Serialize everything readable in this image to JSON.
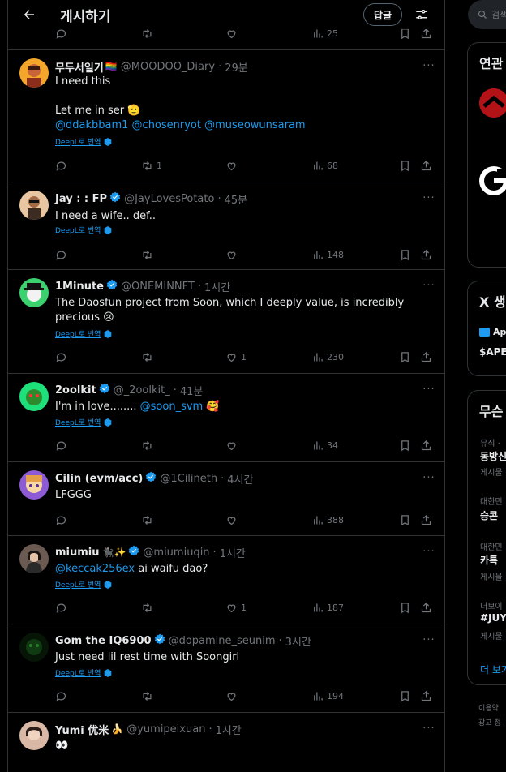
{
  "header": {
    "title": "게시하기",
    "reply_filter_label": "답글"
  },
  "previous_tweet": {
    "views": "25"
  },
  "tweets": [
    {
      "name": "무두서일기",
      "name_badge": "🏳️‍🌈",
      "handle": "@MOODOO_Diary",
      "time": "29분",
      "verified": false,
      "lines": [
        "I need this",
        "",
        "Let me in ser 🫡"
      ],
      "mentions": [
        "@ddakbbam1",
        "@chosenryot",
        "@museowunsaram"
      ],
      "translate": "DeepL로 번역",
      "reposts": "1",
      "likes": "",
      "views": "68",
      "avatar_color": "#f4a62a"
    },
    {
      "name": "Jay : : FP",
      "handle": "@JayLovesPotato",
      "time": "45분",
      "verified": true,
      "text": "I need a wife.. def..",
      "translate": "DeepL로 번역",
      "reposts": "",
      "likes": "",
      "views": "148",
      "avatar_color": "#e9c6a2"
    },
    {
      "name": "1Minute",
      "handle": "@ONEMINNFT",
      "time": "1시간",
      "verified": true,
      "text": "The Daosfun project from Soon, which I deeply value, is incredibly precious 😢",
      "translate": "DeepL로 번역",
      "reposts": "",
      "likes": "1",
      "views": "230",
      "avatar_color": "#3bd16f"
    },
    {
      "name": "2oolkit",
      "handle": "@_2oolkit_",
      "time": "41분",
      "verified": true,
      "text_before": "I'm in love........",
      "mention": "@soon_svm",
      "text_after": "🥰",
      "translate": "DeepL로 번역",
      "reposts": "",
      "likes": "",
      "views": "34",
      "avatar_color": "#1ee07a"
    },
    {
      "name": "Cilin (evm/acc)",
      "handle": "@1Cilineth",
      "time": "4시간",
      "verified": true,
      "text": "LFGGG",
      "reposts": "",
      "likes": "",
      "views": "388",
      "avatar_color": "#8e5bd6"
    },
    {
      "name": "miumiu",
      "name_badge": "🐈‍⬛✨",
      "handle": "@miumiuqin",
      "time": "1시간",
      "verified": true,
      "mention": "@keccak256ex",
      "text_after": "ai waifu dao?",
      "translate": "DeepL로 번역",
      "reposts": "",
      "likes": "1",
      "views": "187",
      "avatar_color": "#6a5a52"
    },
    {
      "name": "Gom the IQ6900",
      "handle": "@dopamine_seunim",
      "time": "3시간",
      "verified": true,
      "text": "Just need lil rest time with Soongirl",
      "translate": "DeepL로 번역",
      "reposts": "",
      "likes": "",
      "views": "194",
      "avatar_color": "#0f3a12"
    },
    {
      "name": "Yumi 优米",
      "name_badge": "🍌",
      "handle": "@yumipeixuan",
      "time": "1시간",
      "verified": false,
      "text": "👀",
      "avatar_color": "#d9b9a6"
    }
  ],
  "sidebar": {
    "search_placeholder": "검색",
    "related_title": "연관",
    "x_title": "X 생",
    "x_item1": "Ap",
    "x_item2": "$APE",
    "trends_title": "무슨",
    "trend1_meta": "뮤직 · ",
    "trend1_title": "동방신",
    "trend1_count": "게시물",
    "trend2_meta": "대한민",
    "trend2_title": "승콘 ",
    "trend3_meta": "대한민",
    "trend3_title": "카톡 ",
    "trend3_count": "게시물",
    "trend4_meta": "더보이",
    "trend4_title": "#JUY",
    "trend4_count": "게시물",
    "show_more": "더 보기",
    "footer1": "이용약",
    "footer2": "광고 정"
  },
  "colors": {
    "accent": "#1d9bf0",
    "muted": "#71767b",
    "border": "#2f3336",
    "verified": "#1d9bf0"
  }
}
